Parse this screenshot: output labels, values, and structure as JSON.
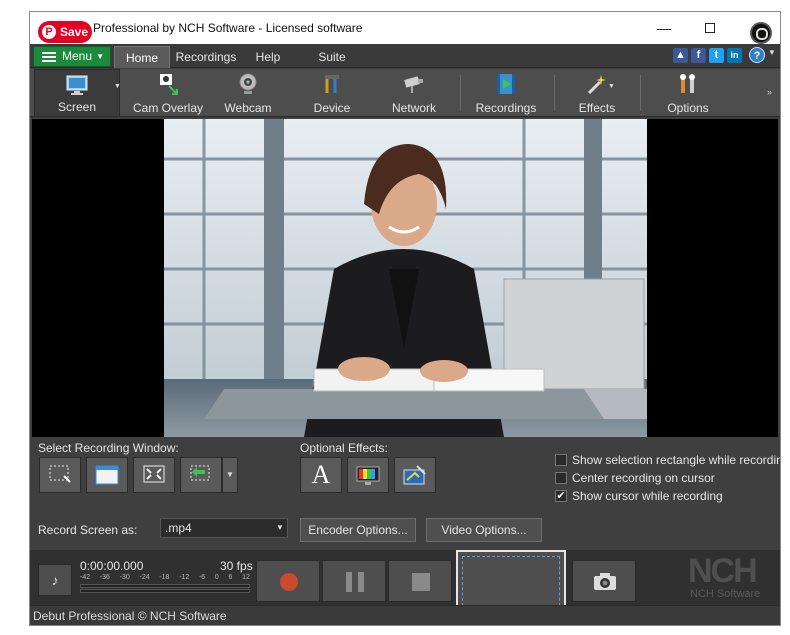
{
  "pin": {
    "save_label": "Save"
  },
  "window": {
    "title": "Professional by NCH Software - Licensed software",
    "minimize": "—"
  },
  "menu": {
    "menu_button": "Menu",
    "tabs": [
      {
        "label": "Home",
        "active": true
      },
      {
        "label": "Recordings"
      },
      {
        "label": "Help"
      },
      {
        "label": "Suite"
      }
    ],
    "social": [
      {
        "icon": "thumbs-up-icon",
        "glyph": "👍",
        "color": "#3b5998"
      },
      {
        "icon": "facebook-icon",
        "glyph": "f",
        "color": "#3b5998"
      },
      {
        "icon": "twitter-icon",
        "glyph": "t",
        "color": "#1da1f2"
      },
      {
        "icon": "linkedin-icon",
        "glyph": "in",
        "color": "#0077b5"
      }
    ],
    "help_glyph": "?"
  },
  "toolbar": {
    "items": [
      {
        "label": "Screen",
        "icon": "monitor-icon",
        "active": true
      },
      {
        "label": "Cam Overlay",
        "icon": "cam-overlay-icon"
      },
      {
        "label": "Webcam",
        "icon": "webcam-icon"
      },
      {
        "label": "Device",
        "icon": "device-icon"
      },
      {
        "label": "Network",
        "icon": "network-camera-icon"
      },
      {
        "label": "Recordings",
        "icon": "recordings-icon"
      },
      {
        "label": "Effects",
        "icon": "magic-wand-icon"
      },
      {
        "label": "Options",
        "icon": "options-icon"
      }
    ],
    "more": "»"
  },
  "controls": {
    "select_window_label": "Select Recording Window:",
    "optional_effects_label": "Optional Effects:",
    "effects_text_glyph": "A",
    "checkboxes": [
      {
        "label": "Show selection rectangle while recording",
        "checked": false
      },
      {
        "label": "Center recording on cursor",
        "checked": false
      },
      {
        "label": "Show cursor while recording",
        "checked": true
      }
    ],
    "record_as_label": "Record Screen as:",
    "format_value": ".mp4",
    "encoder_button": "Encoder Options...",
    "video_button": "Video Options..."
  },
  "transport": {
    "time": "0:00:00.000",
    "fps": "30 fps",
    "meter_ticks": [
      "-42",
      "-36",
      "-30",
      "-24",
      "-18",
      "-12",
      "-6",
      "0",
      "6",
      "12"
    ]
  },
  "logo": {
    "big": "NCH",
    "small": "NCH Software"
  },
  "status": {
    "text": "Debut Professional © NCH Software"
  },
  "colors": {
    "accent_green": "#1c8a3b",
    "record_red": "#c94a2c",
    "pin_red": "#e60023"
  }
}
